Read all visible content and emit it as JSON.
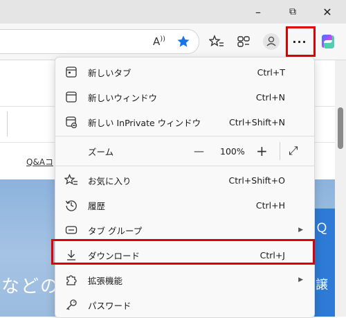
{
  "window": {
    "minimize": "–",
    "restore": "⧉",
    "close": "✕"
  },
  "toolbar": {
    "read_aloud": "A",
    "more_label": "···"
  },
  "page": {
    "link_text": "Q&Aコ",
    "hero_text": "などの",
    "right_char_1": "Ｑ",
    "right_char_2": "譲"
  },
  "menu": {
    "items": [
      {
        "label": "新しいタブ",
        "shortcut": "Ctrl+T"
      },
      {
        "label": "新しいウィンドウ",
        "shortcut": "Ctrl+N"
      },
      {
        "label": "新しい InPrivate ウィンドウ",
        "shortcut": "Ctrl+Shift+N"
      },
      {
        "label": "ズーム",
        "zoom_minus": "—",
        "zoom_value": "100%",
        "zoom_plus": "+",
        "fullscreen": "⤢"
      },
      {
        "label": "お気に入り",
        "shortcut": "Ctrl+Shift+O"
      },
      {
        "label": "履歴",
        "shortcut": "Ctrl+H"
      },
      {
        "label": "タブ グループ",
        "submenu": "▶"
      },
      {
        "label": "ダウンロード",
        "shortcut": "Ctrl+J"
      },
      {
        "label": "拡張機能",
        "submenu": "▶"
      },
      {
        "label": "パスワード"
      }
    ]
  },
  "colors": {
    "highlight": "#e00000",
    "star": "#1a73e8"
  }
}
